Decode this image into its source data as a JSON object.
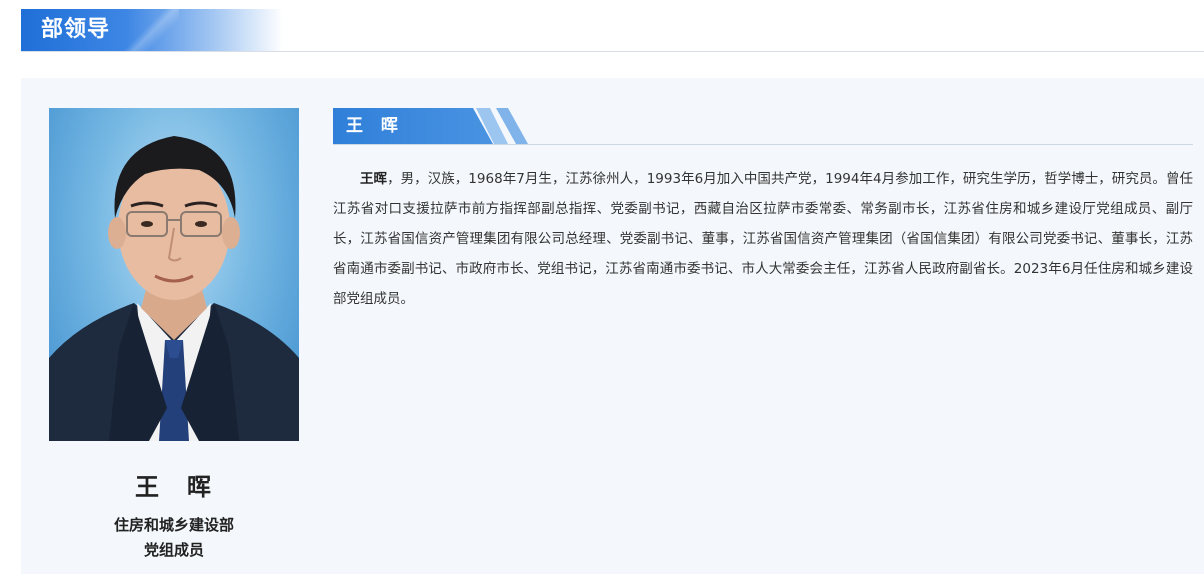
{
  "section": {
    "title": "部领导"
  },
  "leader": {
    "name": "王　晖",
    "name_bar": "王 晖",
    "organization": "住房和城乡建设部",
    "position": "党组成员",
    "bio_name": "王晖",
    "bio_text": "，男，汉族，1968年7月生，江苏徐州人，1993年6月加入中国共产党，1994年4月参加工作，研究生学历，哲学博士，研究员。曾任江苏省对口支援拉萨市前方指挥部副总指挥、党委副书记，西藏自治区拉萨市委常委、常务副市长，江苏省住房和城乡建设厅党组成员、副厅长，江苏省国信资产管理集团有限公司总经理、党委副书记、董事，江苏省国信资产管理集团（省国信集团）有限公司党委书记、董事长，江苏省南通市委副书记、市政府市长、党组书记，江苏省南通市委书记、市人大常委会主任，江苏省人民政府副省长。2023年6月任住房和城乡建设部党组成员。"
  },
  "colors": {
    "accent": "#1f6fd8",
    "panel_bg": "#f4f8fc",
    "text": "#333333"
  }
}
